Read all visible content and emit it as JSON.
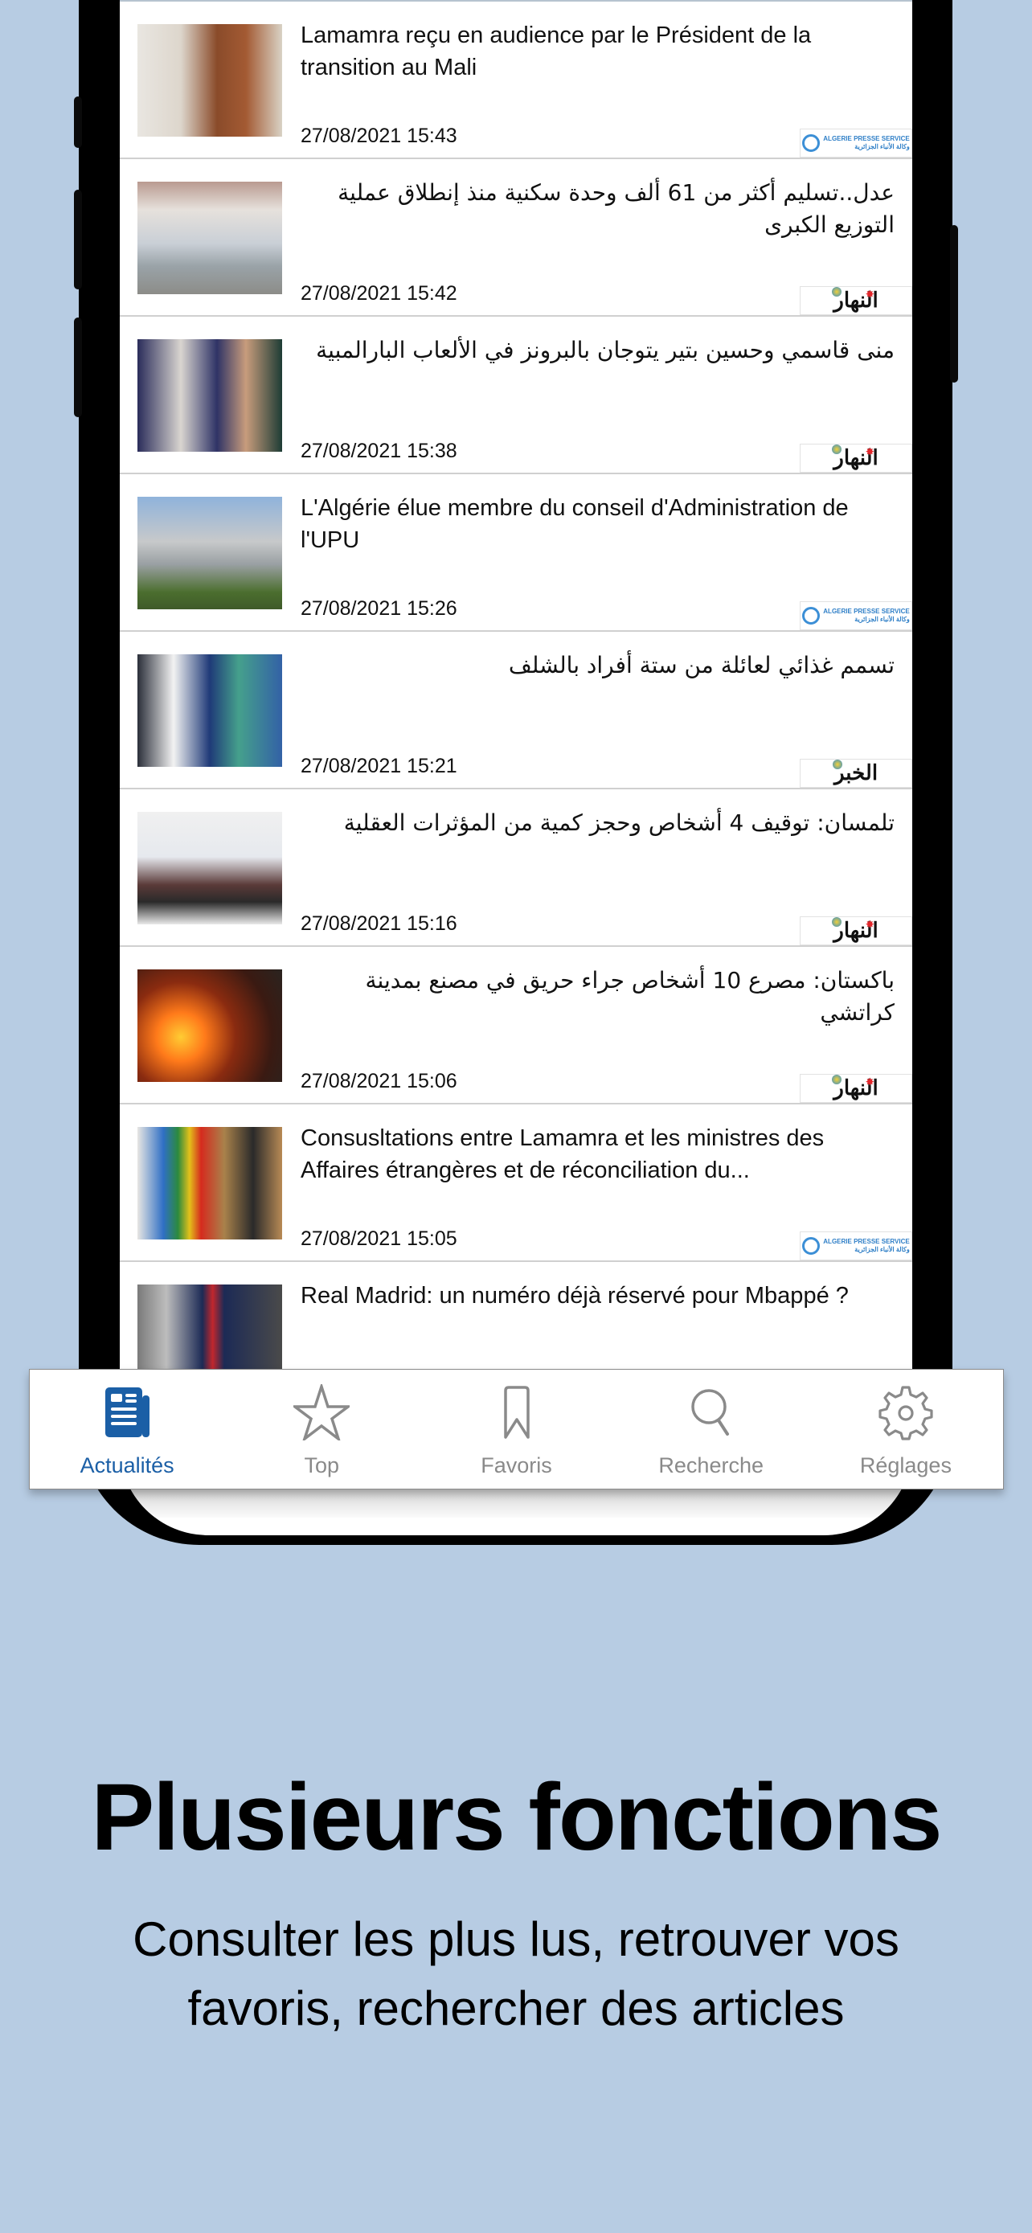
{
  "articles": [
    {
      "title": "Lamamra reçu en audience par le Président de la transition au Mali",
      "date": "27/08/2021 15:43",
      "rtl": false,
      "source": "aps",
      "thumb": "meeting"
    },
    {
      "title": "عدل..تسليم أكثر من 61 ألف وحدة سكنية منذ إنطلاق عملية التوزيع الكبرى",
      "date": "27/08/2021 15:42",
      "rtl": true,
      "source": "ennahar",
      "thumb": "housing"
    },
    {
      "title": "منى قاسمي وحسين بتير يتوجان بالبرونز في الألعاب البارالمبية",
      "date": "27/08/2021 15:38",
      "rtl": true,
      "source": "ennahar",
      "thumb": "athletes"
    },
    {
      "title": "L'Algérie élue membre du conseil d'Administration de l'UPU",
      "date": "27/08/2021 15:26",
      "rtl": false,
      "source": "aps",
      "thumb": "building"
    },
    {
      "title": "تسمم غذائي لعائلة من ستة أفراد بالشلف",
      "date": "27/08/2021 15:21",
      "rtl": true,
      "source": "elkhabar",
      "thumb": "hospital"
    },
    {
      "title": "تلمسان: توقيف 4 أشخاص وحجز كمية من المؤثرات العقلية",
      "date": "27/08/2021 15:16",
      "rtl": true,
      "source": "ennahar",
      "thumb": "arrest"
    },
    {
      "title": "باكستان: مصرع 10 أشخاص جراء حريق في مصنع بمدينة كراتشي",
      "date": "27/08/2021 15:06",
      "rtl": true,
      "source": "ennahar",
      "thumb": "fire"
    },
    {
      "title": "Consusltations entre Lamamra et les ministres des Affaires étrangères et de réconciliation du...",
      "date": "27/08/2021 15:05",
      "rtl": false,
      "source": "aps",
      "thumb": "flags"
    },
    {
      "title": "Real Madrid: un numéro déjà réservé pour Mbappé ?",
      "date": "",
      "rtl": false,
      "source": "",
      "thumb": "football"
    }
  ],
  "sources": {
    "aps": {
      "line1": "ALGERIE PRESSE SERVICE",
      "line2": "وكالة الأنباء الجزائرية"
    },
    "ennahar": {
      "name": "النهار"
    },
    "elkhabar": {
      "name": "الخبر"
    }
  },
  "tabbar": {
    "active_color": "#1b5fa6",
    "inactive_color": "#8a8a8a",
    "tabs": [
      {
        "label": "Actualités",
        "icon": "newspaper-icon",
        "active": true
      },
      {
        "label": "Top",
        "icon": "star-icon",
        "active": false
      },
      {
        "label": "Favoris",
        "icon": "bookmark-icon",
        "active": false
      },
      {
        "label": "Recherche",
        "icon": "search-icon",
        "active": false
      },
      {
        "label": "Réglages",
        "icon": "gear-icon",
        "active": false
      }
    ]
  },
  "promo": {
    "headline": "Plusieurs fonctions",
    "subtitle_line1": "Consulter les plus lus, retrouver vos",
    "subtitle_line2": "favoris, rechercher des articles"
  },
  "colors": {
    "background": "#B7CCE3",
    "accent": "#1b5fa6"
  }
}
